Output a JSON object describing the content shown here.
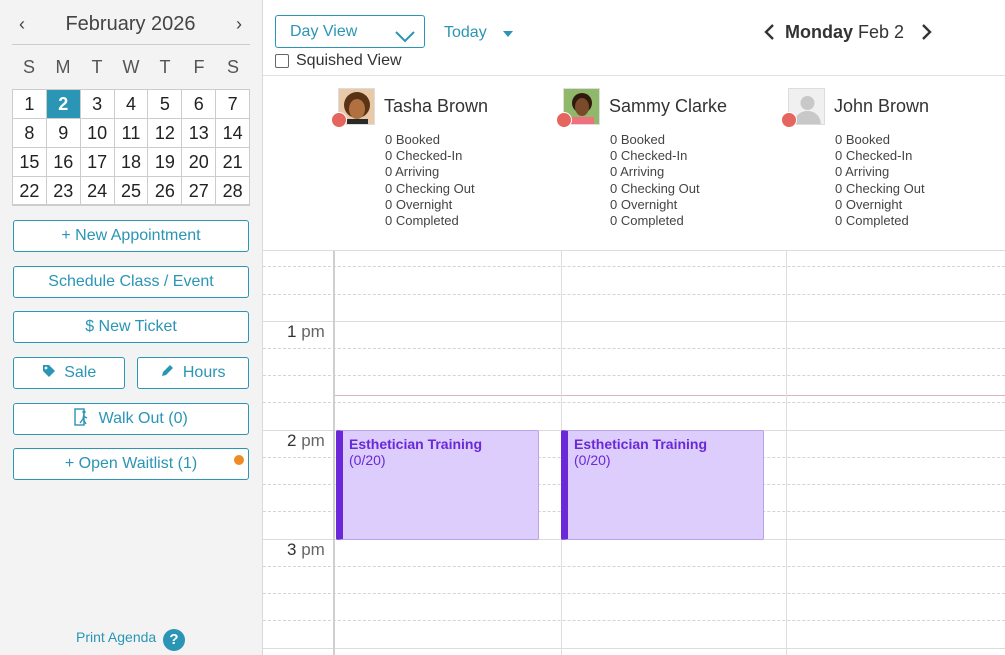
{
  "mini_calendar": {
    "month_title": "February 2026",
    "prev_label": "‹",
    "next_label": "›",
    "weekdays": [
      "S",
      "M",
      "T",
      "W",
      "T",
      "F",
      "S"
    ],
    "weeks": [
      [
        "1",
        "2",
        "3",
        "4",
        "5",
        "6",
        "7"
      ],
      [
        "8",
        "9",
        "10",
        "11",
        "12",
        "13",
        "14"
      ],
      [
        "15",
        "16",
        "17",
        "18",
        "19",
        "20",
        "21"
      ],
      [
        "22",
        "23",
        "24",
        "25",
        "26",
        "27",
        "28"
      ]
    ],
    "selected_day": "2"
  },
  "sidebar": {
    "new_appointment": "+ New Appointment",
    "schedule_class": "Schedule Class / Event",
    "new_ticket": "$  New Ticket",
    "sale": "Sale",
    "hours": "Hours",
    "walk_out": "Walk Out (0)",
    "open_waitlist": "+ Open Waitlist (1)",
    "print_agenda": "Print Agenda",
    "help_glyph": "?"
  },
  "toolbar": {
    "view_select": "Day View",
    "today": "Today",
    "squished_view": "Squished View",
    "weekday": "Monday",
    "date": "Feb 2"
  },
  "staff": [
    {
      "name": "Tasha Brown",
      "stats": [
        "0 Booked",
        "0 Checked-In",
        "0 Arriving",
        "0 Checking Out",
        "0 Overnight",
        "0 Completed"
      ]
    },
    {
      "name": "Sammy Clarke",
      "stats": [
        "0 Booked",
        "0 Checked-In",
        "0 Arriving",
        "0 Checking Out",
        "0 Overnight",
        "0 Completed"
      ]
    },
    {
      "name": "John Brown",
      "stats": [
        "0 Booked",
        "0 Checked-In",
        "0 Arriving",
        "0 Checking Out",
        "0 Overnight",
        "0 Completed"
      ]
    }
  ],
  "time_labels": [
    {
      "hour": "1",
      "suffix": "pm"
    },
    {
      "hour": "2",
      "suffix": "pm"
    },
    {
      "hour": "3",
      "suffix": "pm"
    }
  ],
  "appointments": [
    {
      "title": "Esthetician Training",
      "capacity": "(0/20)"
    },
    {
      "title": "Esthetician Training",
      "capacity": "(0/20)"
    }
  ],
  "colors": {
    "accent": "#2a95b5",
    "appointment_fill": "#dccdfd",
    "appointment_text": "#6a28d9",
    "status_dot": "#e4665e",
    "waitlist_dot": "#f08a24"
  }
}
